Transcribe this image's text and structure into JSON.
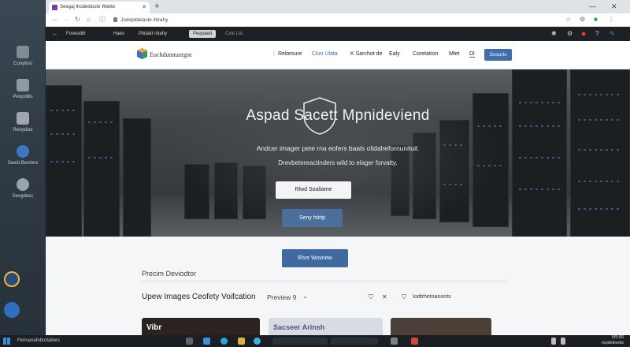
{
  "desktop": {
    "icons": [
      {
        "label": "Cooytioo",
        "color": "#7f8b96"
      },
      {
        "label": "Peopddis",
        "color": "#8d99a4"
      },
      {
        "label": "Renpdiac",
        "color": "#a0a6ad"
      },
      {
        "label": "Seeld Benlons",
        "color": "#3b78c4"
      },
      {
        "label": "Sevgdeec",
        "color": "#9aa3ab"
      }
    ]
  },
  "browser": {
    "tab_title": "Seegaj Ihodeldoste Wahte",
    "url": "Jodopldelasle iltirahy",
    "bookmarks": [
      "Foveoditr",
      "Haes",
      "Pitdaitt ntiahy",
      "Peqoaed",
      "Cxle Litc"
    ]
  },
  "site": {
    "logo_text": "Eochdumtuntgnt",
    "nav": [
      "Rebeoure",
      "Clun Ulata",
      "K Sarchot de",
      "Ealy",
      "Coretation",
      "Mtet",
      "Dl"
    ],
    "nav_button": "Scouris"
  },
  "hero": {
    "title": "Aspad  Sacett Mpnideviend",
    "subtitle1": "Andcer imager pete rna eofers baals olidahefornunituil.",
    "subtitle2": "Drevbetereactinders wild to elager forvatty.",
    "button_light": "Rlwd Soaltame",
    "button_blue": "Seny hitrip"
  },
  "section": {
    "button": "Ehre Wovnew",
    "title": "Precim Deviodtor",
    "updates_title": "Upew Images Ceofety Voifcation",
    "preview_label": "Preview",
    "preview_count": "9",
    "right_label": "Iodtrhetoanonts",
    "cards": [
      "Vibr",
      "Sacseer Arinsh",
      ""
    ]
  },
  "taskbar": {
    "title": "Ferinanafebrotabers",
    "time": "5/5:50",
    "date": "mpdetinetis"
  }
}
